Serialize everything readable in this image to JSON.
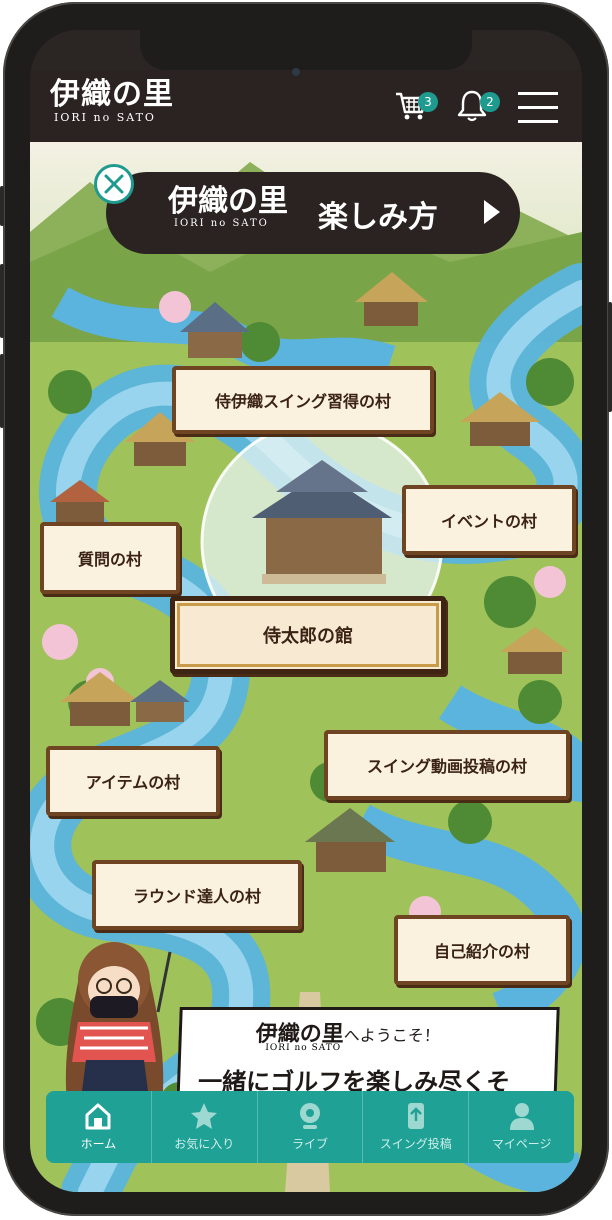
{
  "app": {
    "logo_jp": "伊織の里",
    "logo_en": "IORI no SATO"
  },
  "header": {
    "cart_badge": "3",
    "bell_badge": "2"
  },
  "howto_banner": {
    "logo_jp": "伊織の里",
    "logo_en": "IORI no SATO",
    "title": "楽しみ方"
  },
  "villages": {
    "samurai_swing": "侍伊織スイング習得の村",
    "event": "イベントの村",
    "question": "質問の村",
    "main_hall": "侍太郎の館",
    "item": "アイテムの村",
    "swing_video": "スイング動画投稿の村",
    "round_master": "ラウンド達人の村",
    "self_intro": "自己紹介の村"
  },
  "welcome": {
    "logo_jp": "伊織の里",
    "logo_en": "IORI no SATO",
    "suffix": "へようこそ！",
    "message": "一緒にゴルフを楽しみ尽くそう！"
  },
  "tabs": [
    {
      "label": "ホーム",
      "icon": "home-icon",
      "active": true
    },
    {
      "label": "お気に入り",
      "icon": "star-icon",
      "active": false
    },
    {
      "label": "ライブ",
      "icon": "webcam-icon",
      "active": false
    },
    {
      "label": "スイング投稿",
      "icon": "upload-phone-icon",
      "active": false
    },
    {
      "label": "マイページ",
      "icon": "user-icon",
      "active": false
    }
  ],
  "colors": {
    "accent": "#1fa196",
    "header_bg": "#2a2321",
    "sign_border": "#6f4422"
  }
}
